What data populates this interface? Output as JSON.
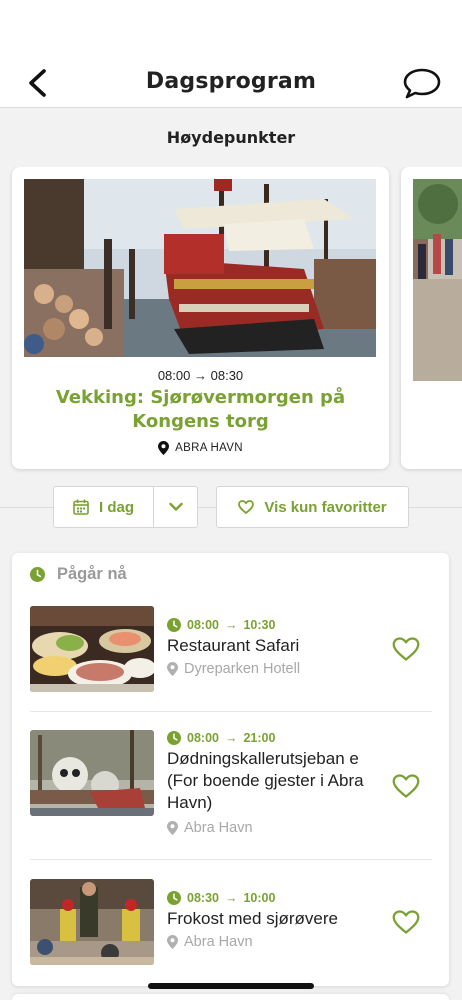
{
  "header": {
    "title": "Dagsprogram",
    "back_icon": "chevron-left-icon",
    "chat_icon": "chat-bubble-icon"
  },
  "highlights": {
    "section_title": "Høydepunkter",
    "cards": [
      {
        "time_start": "08:00",
        "time_end": "08:30",
        "title": "Vekking: Sjørøvermorgen på Kongens torg",
        "location": "ABRA HAVN"
      }
    ]
  },
  "filters": {
    "day_label": "I dag",
    "favorites_label": "Vis kun favoritter"
  },
  "ongoing": {
    "label": "Pågår nå",
    "events": [
      {
        "time_start": "08:00",
        "time_end": "10:30",
        "title": "Restaurant Safari",
        "location": "Dyreparken Hotell"
      },
      {
        "time_start": "08:00",
        "time_end": "21:00",
        "title": "Dødningskallerutsjeban e (For boende gjester i Abra Havn)",
        "location": "Abra Havn"
      },
      {
        "time_start": "08:30",
        "time_end": "10:00",
        "title": "Frokost med sjørøvere",
        "location": "Abra Havn"
      }
    ]
  },
  "colors": {
    "accent": "#7aa232",
    "muted": "#a8a8a8",
    "background": "#f2f2f2"
  },
  "arrow": "→"
}
